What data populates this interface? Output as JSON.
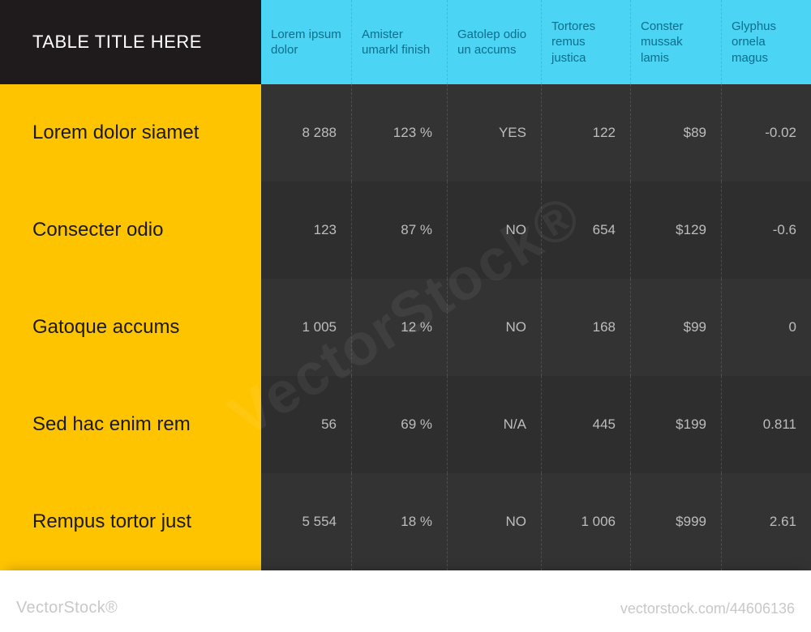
{
  "title": "TABLE TITLE HERE",
  "columns": [
    "Lorem ipsum dolor",
    "Amister umarkl finish",
    "Gatolep odio un accums",
    "Tortores remus justica",
    "Conster mussak lamis",
    "Glyphus ornela magus"
  ],
  "rows": [
    {
      "label": "Lorem dolor siamet",
      "cells": [
        "8 288",
        "123 %",
        "YES",
        "122",
        "$89",
        "-0.02"
      ]
    },
    {
      "label": "Consecter odio",
      "cells": [
        "123",
        "87 %",
        "NO",
        "654",
        "$129",
        "-0.6"
      ]
    },
    {
      "label": "Gatoque accums",
      "cells": [
        "1 005",
        "12 %",
        "NO",
        "168",
        "$99",
        "0"
      ]
    },
    {
      "label": "Sed hac enim rem",
      "cells": [
        "56",
        "69 %",
        "N/A",
        "445",
        "$199",
        "0.811"
      ]
    },
    {
      "label": "Rempus tortor just",
      "cells": [
        "5 554",
        "18 %",
        "NO",
        "1 006",
        "$999",
        "2.61"
      ]
    }
  ],
  "watermark": {
    "diagonal": "VectorStock®",
    "left_prefix": "",
    "left_brand": "VectorStock®",
    "right": "vectorstock.com/44606136"
  },
  "chart_data": {
    "type": "table",
    "title": "TABLE TITLE HERE",
    "columns": [
      "",
      "Lorem ipsum dolor",
      "Amister umarkl finish",
      "Gatolep odio un accums",
      "Tortores remus justica",
      "Conster mussak lamis",
      "Glyphus ornela magus"
    ],
    "rows": [
      [
        "Lorem dolor siamet",
        "8 288",
        "123 %",
        "YES",
        "122",
        "$89",
        "-0.02"
      ],
      [
        "Consecter odio",
        "123",
        "87 %",
        "NO",
        "654",
        "$129",
        "-0.6"
      ],
      [
        "Gatoque accums",
        "1 005",
        "12 %",
        "NO",
        "168",
        "$99",
        "0"
      ],
      [
        "Sed hac enim rem",
        "56",
        "69 %",
        "N/A",
        "445",
        "$199",
        "0.811"
      ],
      [
        "Rempus tortor just",
        "5 554",
        "18 %",
        "NO",
        "1 006",
        "$999",
        "2.61"
      ]
    ]
  }
}
